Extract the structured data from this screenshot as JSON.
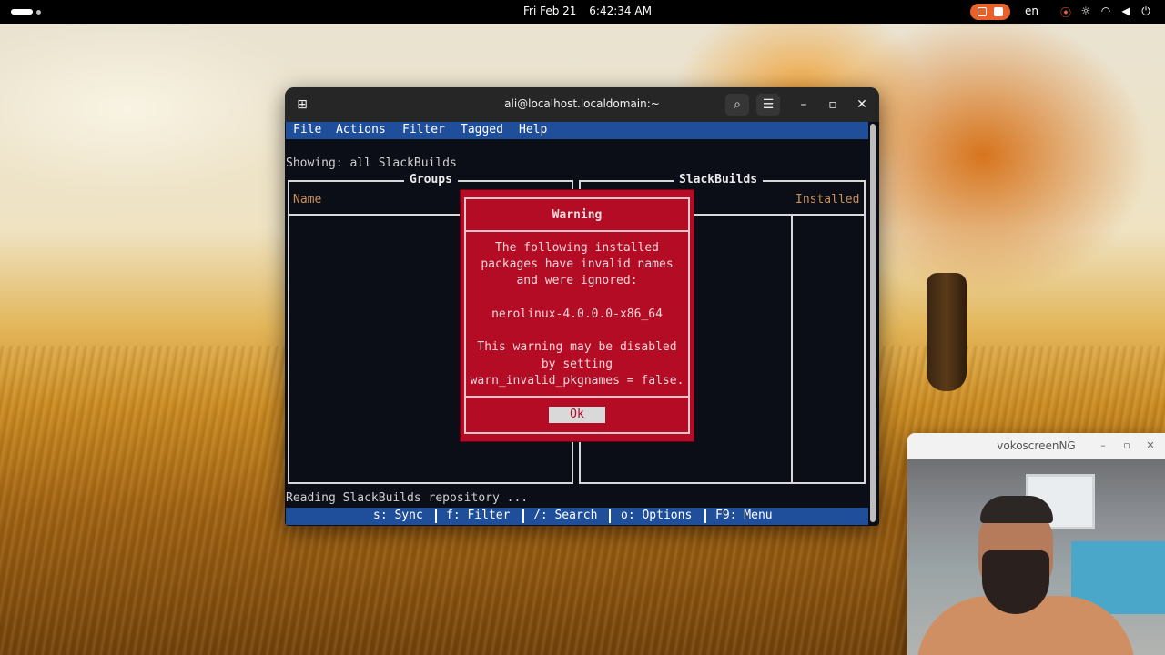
{
  "topbar": {
    "date": "Fri Feb 21",
    "time": "6:42:34 AM",
    "language": "en",
    "icons": [
      "activities-icon",
      "screen-record-icon",
      "stop-record-icon",
      "screencast-icon",
      "brightness-icon",
      "wifi-icon",
      "volume-icon",
      "power-icon"
    ],
    "record_color": "#e8612a"
  },
  "terminal": {
    "title": "ali@localhost.localdomain:~",
    "menu": [
      "File",
      "Actions",
      "Filter",
      "Tagged",
      "Help"
    ],
    "showing": "Showing: all SlackBuilds",
    "groups_title": "Groups",
    "groups_col": "Name",
    "slackbuilds_title": "SlackBuilds",
    "slackbuilds_col": "Installed",
    "status_line": "Reading SlackBuilds repository ...",
    "shortcuts": [
      "s: Sync",
      "f: Filter",
      "/: Search",
      "o: Options",
      "F9: Menu"
    ],
    "menu_color": "#1f4f9b"
  },
  "dialog": {
    "title": "Warning",
    "lines": [
      "The following installed",
      "packages have invalid names",
      "and were ignored:",
      "",
      "nerolinux-4.0.0.0-x86_64",
      "",
      "This warning may be disabled",
      "by setting",
      "warn_invalid_pkgnames = false."
    ],
    "button": "Ok",
    "bg_color": "#b50c25"
  },
  "vokoscreen": {
    "title": "vokoscreenNG"
  }
}
